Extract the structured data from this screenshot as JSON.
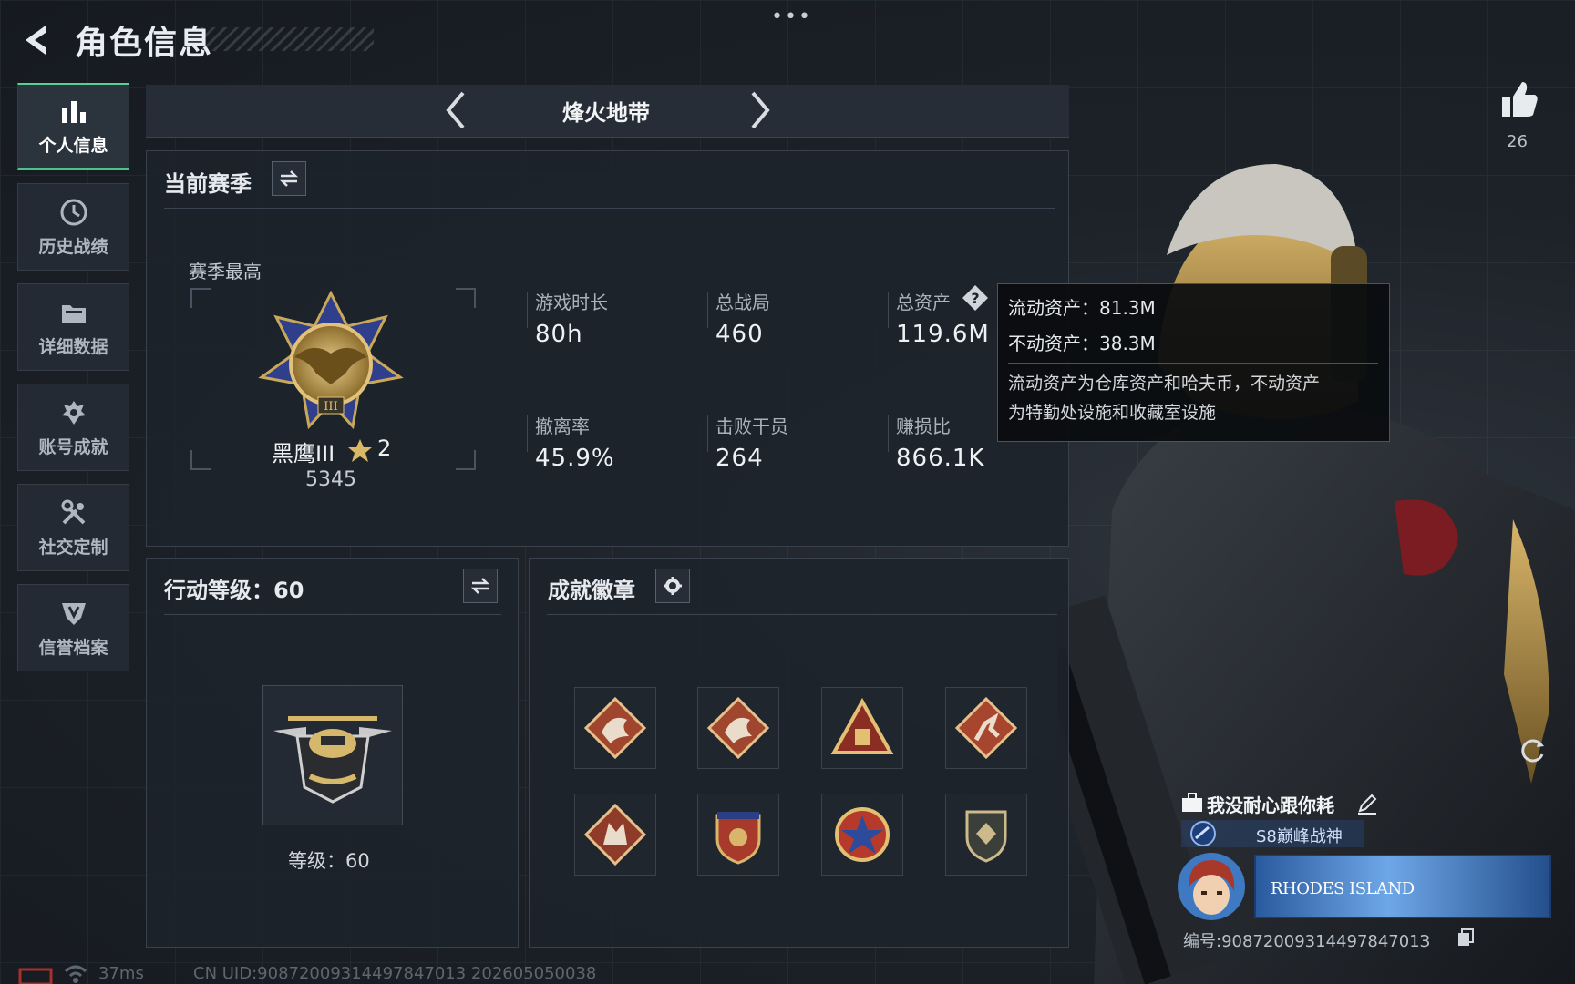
{
  "header": {
    "title": "角色信息"
  },
  "sidebar": {
    "items": [
      {
        "label": "个人信息",
        "icon": "bar-chart-icon",
        "active": true
      },
      {
        "label": "历史战绩",
        "icon": "history-icon"
      },
      {
        "label": "详细数据",
        "icon": "folder-icon"
      },
      {
        "label": "账号成就",
        "icon": "achievement-icon"
      },
      {
        "label": "社交定制",
        "icon": "tools-icon"
      },
      {
        "label": "信誉档案",
        "icon": "shield-badge-icon"
      }
    ]
  },
  "mode": {
    "name": "烽火地带"
  },
  "season": {
    "title": "当前赛季",
    "best_label": "赛季最高",
    "rank_name": "黑鹰III",
    "rank_stars": "2",
    "rank_points": "5345",
    "stats": [
      {
        "label": "游戏时长",
        "value": "80h"
      },
      {
        "label": "总战局",
        "value": "460"
      },
      {
        "label": "总资产",
        "value": "119.6M"
      },
      {
        "label": "撤离率",
        "value": "45.9%"
      },
      {
        "label": "击败干员",
        "value": "264"
      },
      {
        "label": "赚损比",
        "value": "866.1K"
      }
    ]
  },
  "tooltip": {
    "liquid": "流动资产：81.3M",
    "fixed": "不动资产：38.3M",
    "desc_line1": "流动资产为仓库资产和哈夫币，不动资产",
    "desc_line2": "为特勤处设施和收藏室设施"
  },
  "action_level": {
    "title": "行动等级：60",
    "caption": "等级：60"
  },
  "badges": {
    "title": "成就徽章",
    "items": [
      "dragon-badge-icon",
      "dragon-badge-icon",
      "triangle-badge-icon",
      "runner-badge-icon",
      "wolf-badge-icon",
      "crest-badge-icon",
      "star-medal-icon",
      "shield-emblem-icon"
    ]
  },
  "likes": {
    "count": "26"
  },
  "player": {
    "name": "我没耐心跟你耗",
    "title": "S8巅峰战神",
    "banner": "RHODES ISLAND",
    "id_line": "编号:9087200931449784701З"
  },
  "footer": {
    "ping": "37ms",
    "uid": "CN UID:908720093144978470​13 202605050038"
  },
  "colors": {
    "accent_green": "#4cc38a",
    "gold": "#c9a85a",
    "panel": "#1d232b"
  }
}
